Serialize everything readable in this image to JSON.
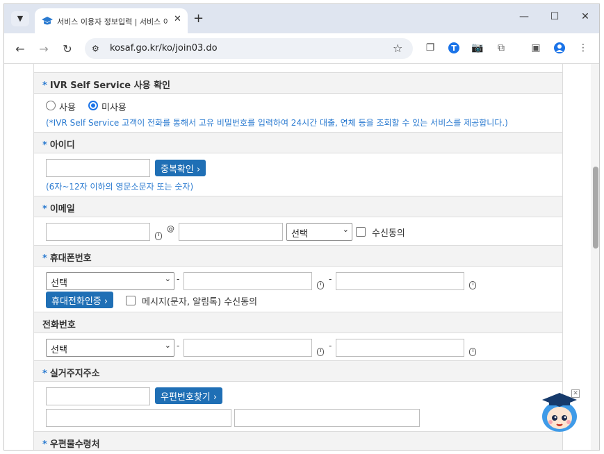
{
  "browser": {
    "tab_title": "서비스 이용자 정보입력 | 서비스 이용",
    "url": "kosaf.go.kr/ko/join03.do"
  },
  "form": {
    "ivr": {
      "title": "IVR Self Service 사용 확인",
      "options": [
        "사용",
        "미사용"
      ],
      "selected": "미사용",
      "hint": "(*IVR Self Service 고객이 전화를 통해서 고유 비밀번호를 입력하여 24시간 대출, 연체 등을 조회할 수 있는 서비스를 제공합니다.)"
    },
    "userid": {
      "title": "아이디",
      "check_button": "중복확인",
      "hint": "(6자~12자 이하의 영문소문자 또는 숫자)"
    },
    "email": {
      "title": "이메일",
      "at": "@",
      "select_value": "선택",
      "consent_label": "수신동의"
    },
    "mobile": {
      "title": "휴대폰번호",
      "select_value": "선택",
      "verify_button": "휴대전화인증",
      "consent_label": "메시지(문자, 알림톡) 수신동의"
    },
    "phone": {
      "title": "전화번호",
      "select_value": "선택"
    },
    "address": {
      "title": "실거주지주소",
      "zip_button": "우편번호찾기"
    },
    "mail_recipient": {
      "title": "우편물수령처"
    },
    "required_mark": "*",
    "dash": "-",
    "arrow": "›"
  },
  "colors": {
    "accent": "#1f6fb5",
    "hint_text": "#2a7ad0",
    "header_bg": "#f3f3f3"
  }
}
